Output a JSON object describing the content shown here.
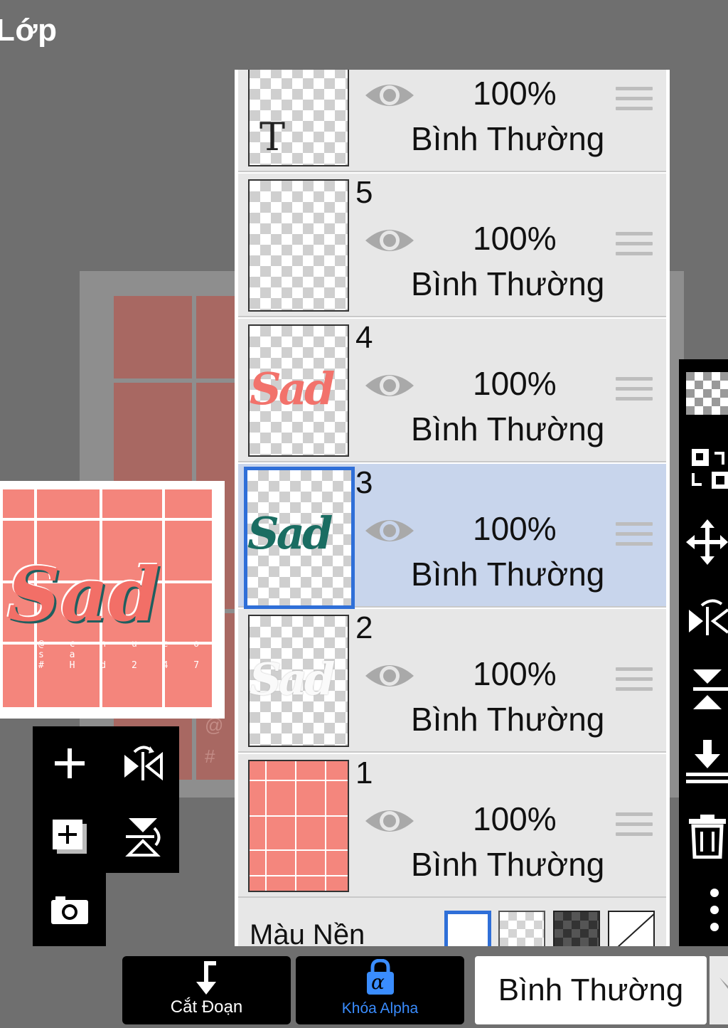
{
  "header": {
    "title": "Lớp"
  },
  "preview": {
    "art_word": "Sad",
    "handle_line1": "@ c h u c o s a",
    "handle_line2": "# H d 2 4 7"
  },
  "layers": [
    {
      "name": "",
      "thumb": "T",
      "visible": true,
      "opacity": "100%",
      "blend": "Bình Thường",
      "selected": false
    },
    {
      "name": "5",
      "thumb": "",
      "visible": true,
      "opacity": "100%",
      "blend": "Bình Thường",
      "selected": false
    },
    {
      "name": "4",
      "thumb": "Sad",
      "visible": true,
      "opacity": "100%",
      "blend": "Bình Thường",
      "selected": false
    },
    {
      "name": "3",
      "thumb": "Sad",
      "visible": true,
      "opacity": "100%",
      "blend": "Bình Thường",
      "selected": true
    },
    {
      "name": "2",
      "thumb": "Sad",
      "visible": true,
      "opacity": "100%",
      "blend": "Bình Thường",
      "selected": false
    },
    {
      "name": "1",
      "thumb": "",
      "visible": true,
      "opacity": "100%",
      "blend": "Bình Thường",
      "selected": false
    }
  ],
  "background_row": {
    "label": "Màu Nền",
    "options": [
      "white",
      "checker-light",
      "checker-dark",
      "none"
    ],
    "selected": "white"
  },
  "canvas_marks": {
    "at": "@",
    "hash": "#"
  },
  "left_tools": [
    "add-layer",
    "flip-horizontal",
    "add-layer-copy",
    "flip-vertical",
    "camera"
  ],
  "right_tools": [
    "transparency",
    "swap-layers",
    "move",
    "flip-h",
    "flip-v",
    "merge-down",
    "delete",
    "more"
  ],
  "bottom_bar": {
    "clip_label": "Cắt Đoạn",
    "alpha_lock_label": "Khóa Alpha",
    "alpha_symbol": "α",
    "blend_mode": "Bình Thường"
  },
  "colors": {
    "selected_layer": "#c8d5ec",
    "accent_blue": "#2f6fd8",
    "alpha_blue": "#3a8dff"
  }
}
